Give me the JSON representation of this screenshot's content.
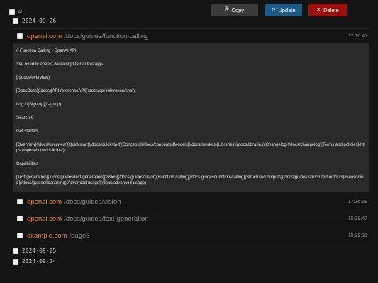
{
  "toolbar": {
    "copy_label": "Copy",
    "update_label": "Update",
    "delete_label": "Delete"
  },
  "select_all_label": "All",
  "dates": [
    "2024-09-26",
    "2024-09-25",
    "2024-09-24"
  ],
  "entries": [
    {
      "domain": "openai.com",
      "path": "/docs/guides/function-calling",
      "time": "17:36:41",
      "expanded": true
    },
    {
      "domain": "openai.com",
      "path": "/docs/guides/vision",
      "time": "17:36:38"
    },
    {
      "domain": "openai.com",
      "path": "/docs/guides/text-generation",
      "time": "15:39:47"
    },
    {
      "domain": "example.com",
      "path": "/page3",
      "time": "15:39:31"
    }
  ],
  "content_lines": [
    "# Function Calling - OpenAI API",
    "You need to enable JavaScript to run this app.",
    "[](/docs/overview)",
    "[DocsDocs](/docs)[API referenceAPI](/docs/api-reference/chat)",
    "Log in[Sign up](/signup)",
    "SearchK",
    "Get started",
    "[Overview](/docs/overview)[Quickstart](/docs/quickstart)[Concepts](/docs/concepts)[Models](/docs/models)[Libraries](/docs/libraries)[Changelog](/docs/changelog)[Terms and policies](https://openai.com/policies/)",
    "Capabilities",
    "[Text generation](/docs/guides/text-generation)[Vision](/docs/guides/vision)[Function calling](/docs/guides/function-calling)[Structured outputs](/docs/guides/structured-outputs)[Reasoning](/docs/guides/reasoning)[Advanced usage](/docs/advanced-usage)"
  ],
  "icons": {
    "copy": "copy-icon",
    "update": "refresh-icon",
    "delete": "close-icon"
  }
}
